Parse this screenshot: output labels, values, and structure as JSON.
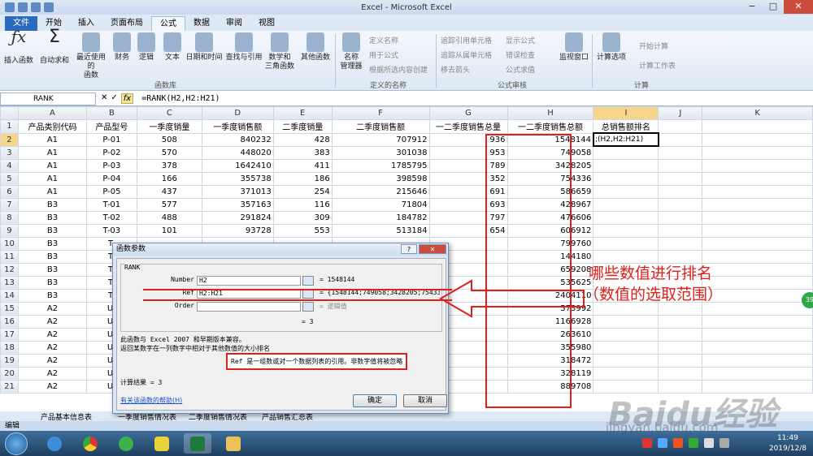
{
  "window": {
    "title": "Excel - Microsoft Excel",
    "min": "−",
    "max": "□",
    "close": "✕"
  },
  "tabs": [
    "文件",
    "开始",
    "插入",
    "页面布局",
    "公式",
    "数据",
    "审阅",
    "视图"
  ],
  "ribbon": {
    "insert_function": "插入函数",
    "autosum": "自动求和",
    "recent": "最近使用的",
    "recent2": "函数",
    "finance": "财务",
    "logic": "逻辑",
    "text": "文本",
    "datetime": "日期和时间",
    "lookup": "查找与引用",
    "math": "数学和",
    "math2": "三角函数",
    "other": "其他函数",
    "group_lib": "函数库",
    "name_mgr": "名称",
    "name_mgr2": "管理器",
    "define_name": "定义名称",
    "use_in_formula": "用于公式",
    "create_from_sel": "根据所选内容创建",
    "group_names": "定义的名称",
    "trace_prec": "追踪引用单元格",
    "trace_dep": "追踪从属单元格",
    "remove_arrows": "移去箭头",
    "show_formulas": "显示公式",
    "error_check": "错误检查",
    "eval_formula": "公式求值",
    "group_audit": "公式审核",
    "watch": "监视窗口",
    "calc_options": "计算选项",
    "calc_now": "开始计算",
    "calc_sheet": "计算工作表",
    "group_calc": "计算"
  },
  "formula_bar": {
    "name_box": "RANK",
    "fx": "fx",
    "cancel": "✕",
    "enter": "✓",
    "formula": "=RANK(H2,H2:H21)"
  },
  "columns": [
    "A",
    "B",
    "C",
    "D",
    "E",
    "F",
    "G",
    "H",
    "I",
    "J",
    "K"
  ],
  "headers": [
    "产品类别代码",
    "产品型号",
    "一季度销量",
    "一季度销售额",
    "二季度销量",
    "二季度销售额",
    "一二季度销售总量",
    "一二季度销售总额",
    "总销售额排名"
  ],
  "rows": [
    [
      "A1",
      "P-01",
      "508",
      "840232",
      "428",
      "707912",
      "936",
      "1548144"
    ],
    [
      "A1",
      "P-02",
      "570",
      "448020",
      "383",
      "301038",
      "953",
      "749058"
    ],
    [
      "A1",
      "P-03",
      "378",
      "1642410",
      "411",
      "1785795",
      "789",
      "3428205"
    ],
    [
      "A1",
      "P-04",
      "166",
      "355738",
      "186",
      "398598",
      "352",
      "754336"
    ],
    [
      "A1",
      "P-05",
      "437",
      "371013",
      "254",
      "215646",
      "691",
      "586659"
    ],
    [
      "B3",
      "T-01",
      "577",
      "357163",
      "116",
      "71804",
      "693",
      "428967"
    ],
    [
      "B3",
      "T-02",
      "488",
      "291824",
      "309",
      "184782",
      "797",
      "476606"
    ],
    [
      "B3",
      "T-03",
      "101",
      "93728",
      "553",
      "513184",
      "654",
      "606912"
    ],
    [
      "B3",
      "T-",
      "",
      "",
      "",
      "",
      "",
      "799760"
    ],
    [
      "B3",
      "T-",
      "",
      "",
      "",
      "",
      "",
      "144180"
    ],
    [
      "B3",
      "T-",
      "",
      "",
      "",
      "",
      "",
      "659208"
    ],
    [
      "B3",
      "T-",
      "",
      "",
      "",
      "",
      "",
      "535625"
    ],
    [
      "B3",
      "T-",
      "",
      "",
      "",
      "",
      "",
      "2404110"
    ],
    [
      "A2",
      "U-",
      "",
      "",
      "",
      "",
      "",
      "573992"
    ],
    [
      "A2",
      "U-",
      "",
      "",
      "",
      "",
      "",
      "1166928"
    ],
    [
      "A2",
      "U-",
      "",
      "",
      "",
      "",
      "",
      "263610"
    ],
    [
      "A2",
      "U-",
      "",
      "",
      "",
      "",
      "",
      "355980"
    ],
    [
      "A2",
      "U-",
      "",
      "",
      "",
      "",
      "",
      "318472"
    ],
    [
      "A2",
      "U-",
      "",
      "",
      "",
      "",
      "",
      "328119"
    ],
    [
      "A2",
      "U-",
      "",
      "",
      "",
      "",
      "",
      "889708"
    ]
  ],
  "active_cell_text": ";(H2,H2:H21)",
  "sheets": {
    "s1": "产品基本信息表",
    "s2": "一季度销售情况表",
    "s3": "二季度销售情况表",
    "s4": "产品销售汇总表"
  },
  "status": "编辑",
  "dialog": {
    "title": "函数参数",
    "help": "?",
    "close": "✕",
    "func": "RANK",
    "args": [
      {
        "label": "Number",
        "value": "H2",
        "result": "= 1548144"
      },
      {
        "label": "Ref",
        "value": "H2:H21",
        "result": "= {1548144;749058;3428205;754336;58"
      },
      {
        "label": "Order",
        "value": "",
        "result": "= 逻辑值"
      }
    ],
    "eq3": "= 3",
    "desc1": "此函数与 Excel 2007 和早期版本兼容。",
    "desc2": "返回某数字在一列数字中相对于其他数值的大小排名",
    "ref_help": "Ref  是一组数或对一个数据列表的引用。非数字值将被忽略",
    "calc_result": "计算结果 =  3",
    "help_link": "有关该函数的帮助(H)",
    "ok": "确定",
    "cancel": "取消"
  },
  "annotation": {
    "line1": "哪些数值进行排名",
    "line2": "（数值的选取范围）"
  },
  "watermark": {
    "logo": "Baidu",
    "logo_cn": "经验",
    "url": "jingyan.baidu.com"
  },
  "side_badge": "39",
  "clock": {
    "time": "11:49",
    "date": "2019/12/8"
  }
}
